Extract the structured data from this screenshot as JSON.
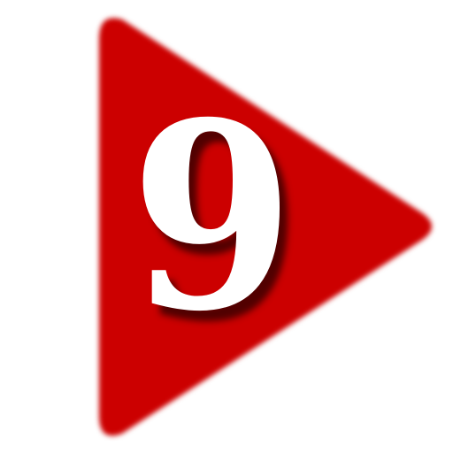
{
  "icon": {
    "name": "play-triangle-icon",
    "label": "9"
  },
  "colors": {
    "background": "#ffffff",
    "triangle": "#cc0000",
    "digit": "#ffffff"
  }
}
